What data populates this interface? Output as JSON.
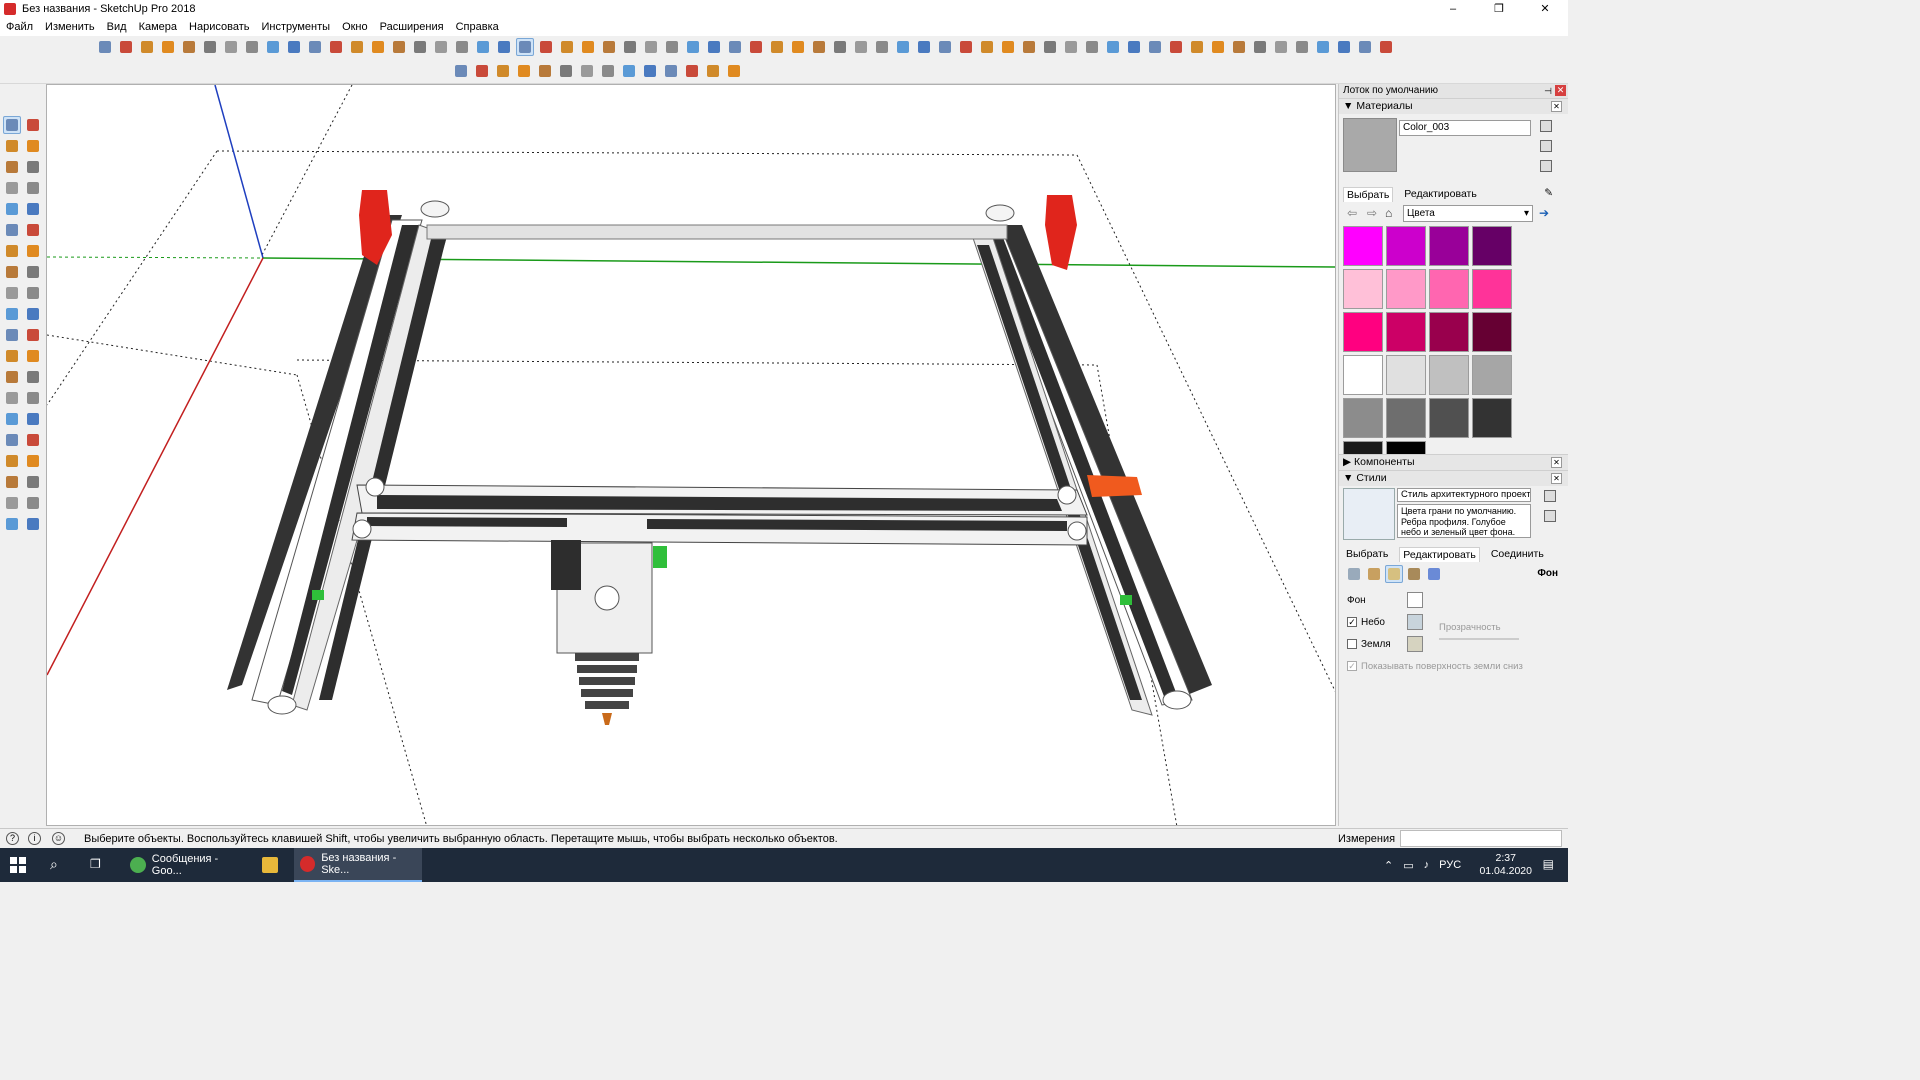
{
  "window": {
    "title": "Без названия - SketchUp Pro 2018",
    "controls": [
      "–",
      "❐",
      "✕"
    ]
  },
  "menu": [
    "Файл",
    "Изменить",
    "Вид",
    "Камера",
    "Нарисовать",
    "Инструменты",
    "Окно",
    "Расширения",
    "Справка"
  ],
  "tray": {
    "title": "Лоток по умолчанию",
    "materials": {
      "header": "Материалы",
      "name": "Color_003",
      "tab_select": "Выбрать",
      "tab_edit": "Редактировать",
      "collection": "Цвета",
      "swatches": [
        "#ff00ff",
        "#cc00cc",
        "#990099",
        "#660066",
        "#ffc0d8",
        "#ff99c8",
        "#ff66b0",
        "#ff3399",
        "#ff0080",
        "#cc0066",
        "#99004d",
        "#660033",
        "#ffffff",
        "#e0e0e0",
        "#c0c0c0",
        "#a6a6a6",
        "#8c8c8c",
        "#6e6e6e",
        "#505050",
        "#333333",
        "#1a1a1a",
        "#000000"
      ]
    },
    "components": {
      "header": "Компоненты"
    },
    "styles": {
      "header": "Стили",
      "name": "Стиль архитектурного проект",
      "description": "Цвета грани по умолчанию. Ребра профиля. Голубое небо и зеленый цвет фона.",
      "tab_select": "Выбрать",
      "tab_edit": "Редактировать",
      "tab_mix": "Соединить",
      "section_label": "Фон",
      "bg_label": "Фон",
      "sky_label": "Небо",
      "ground_label": "Земля",
      "transparency_label": "Прозрачность",
      "show_ground_label": "Показывать поверхность земли сниз",
      "bg_color": "#ffffff",
      "sky_color": "#c8d4dc",
      "ground_color": "#d6d3c0"
    }
  },
  "status": {
    "hint": "Выберите объекты. Воспользуйтесь клавишей Shift, чтобы увеличить выбранную область. Перетащите мышь, чтобы выбрать несколько объектов.",
    "measure_label": "Измерения"
  },
  "taskbar": {
    "tasks": [
      {
        "label": "Сообщения - Goo...",
        "icon_color": "#4caf50"
      },
      {
        "label": "Без названия - Ske...",
        "icon_color": "#d52b2b"
      }
    ],
    "lang": "РУС",
    "time": "2:37",
    "date": "01.04.2020"
  },
  "colors": {
    "axis_blue": "#1f3fbf",
    "axis_green": "#1a9a1a",
    "axis_red": "#c21f1f",
    "frame_red": "#e0251c",
    "frame_orange": "#f05a1e",
    "belt": "#3b3b3b"
  }
}
